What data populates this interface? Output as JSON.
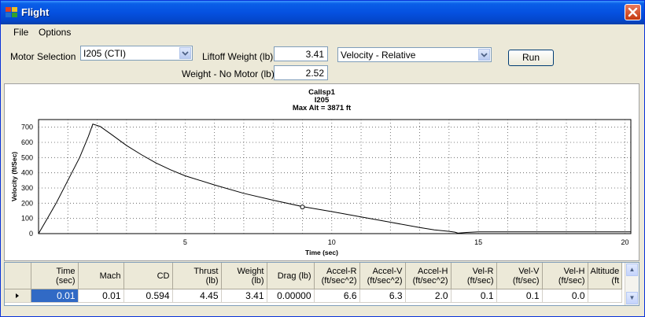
{
  "window": {
    "title": "Flight"
  },
  "menu": {
    "items": [
      "File",
      "Options"
    ]
  },
  "controls": {
    "motor_label": "Motor Selection",
    "motor_value": "I205  (CTI)",
    "liftoff_label": "Liftoff Weight (lb)",
    "liftoff_value": "3.41",
    "nomotor_label": "Weight - No Motor (lb)",
    "nomotor_value": "2.52",
    "plot_value": "Velocity - Relative",
    "run_label": "Run"
  },
  "chart_data": {
    "type": "line",
    "title_lines": [
      "Callsp1",
      "I205",
      "Max Alt = 3871 ft"
    ],
    "xlabel": "Time (sec)",
    "ylabel": "Velocity (ft/Sec)",
    "xlim": [
      0,
      20.2
    ],
    "ylim": [
      0,
      750
    ],
    "x_ticks": [
      5,
      10,
      15,
      20
    ],
    "y_ticks": [
      0,
      100,
      200,
      300,
      400,
      500,
      600,
      700
    ],
    "grid": true,
    "marker": {
      "x": 9.0,
      "y": 175
    },
    "series": [
      {
        "x": [
          0,
          0.3,
          0.6,
          1.0,
          1.4,
          1.7,
          1.85,
          2.1,
          2.5,
          3,
          3.5,
          4,
          4.5,
          5,
          6,
          7,
          8,
          9,
          10,
          11,
          12,
          13,
          13.5,
          14,
          14.2,
          14.3,
          14.6,
          15,
          16,
          17,
          18,
          19,
          20.2
        ],
        "y": [
          0,
          100,
          200,
          350,
          500,
          640,
          720,
          705,
          650,
          580,
          520,
          465,
          420,
          380,
          320,
          265,
          220,
          178,
          145,
          110,
          75,
          40,
          25,
          15,
          10,
          3,
          8,
          12,
          12,
          12,
          12,
          12,
          12
        ]
      }
    ]
  },
  "grid": {
    "columns": [
      {
        "line1": "Time",
        "line2": "(sec)"
      },
      {
        "line1": "Mach",
        "line2": ""
      },
      {
        "line1": "CD",
        "line2": ""
      },
      {
        "line1": "Thrust",
        "line2": "(lb)"
      },
      {
        "line1": "Weight",
        "line2": "(lb)"
      },
      {
        "line1": "Drag (lb)",
        "line2": ""
      },
      {
        "line1": "Accel-R",
        "line2": "(ft/sec^2)"
      },
      {
        "line1": "Accel-V",
        "line2": "(ft/sec^2)"
      },
      {
        "line1": "Accel-H",
        "line2": "(ft/sec^2)"
      },
      {
        "line1": "Vel-R",
        "line2": "(ft/sec)"
      },
      {
        "line1": "Vel-V",
        "line2": "(ft/sec)"
      },
      {
        "line1": "Vel-H",
        "line2": "(ft/sec)"
      },
      {
        "line1": "Altitude",
        "line2": "(ft"
      }
    ],
    "rows": [
      [
        "0.01",
        "0.01",
        "0.594",
        "4.45",
        "3.41",
        "0.00000",
        "6.6",
        "6.3",
        "2.0",
        "0.1",
        "0.1",
        "0.0",
        ""
      ]
    ]
  }
}
